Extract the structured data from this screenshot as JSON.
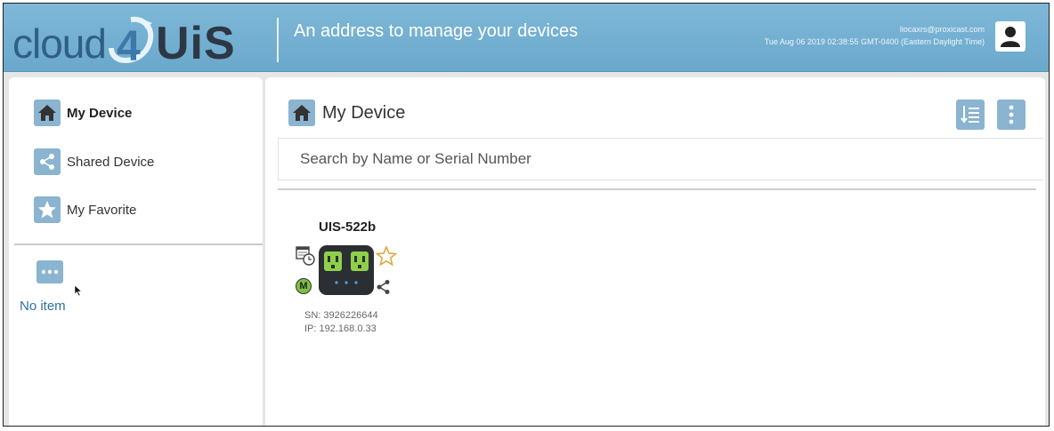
{
  "header": {
    "logo_prefix": "cloud",
    "logo_digit": "4",
    "logo_suffix": "UiS",
    "tagline": "An address to manage your devices",
    "user_email": "liocaxrs@proxicast.com",
    "datetime": "Tue Aug 06 2019 02:38:55 GMT-0400 (Eastern Daylight Time)"
  },
  "sidebar": {
    "items": [
      {
        "label": "My Device",
        "icon": "home-icon",
        "active": true
      },
      {
        "label": "Shared Device",
        "icon": "share-icon",
        "active": false
      },
      {
        "label": "My Favorite",
        "icon": "star-icon",
        "active": false
      }
    ],
    "more_icon": "more-icon",
    "empty_text": "No item"
  },
  "main": {
    "title": "My Device",
    "search_placeholder": "Search by Name or Serial Number",
    "devices": [
      {
        "name": "UIS-522b",
        "sn": "SN: 3926226644",
        "ip": "IP: 192.168.0.33",
        "mode_badge": "M"
      }
    ]
  },
  "colors": {
    "header_bg": "#6aa8cc",
    "icon_bg": "#8ab4d0",
    "link": "#2f6fa6",
    "outlet_green": "#8fd04a"
  }
}
